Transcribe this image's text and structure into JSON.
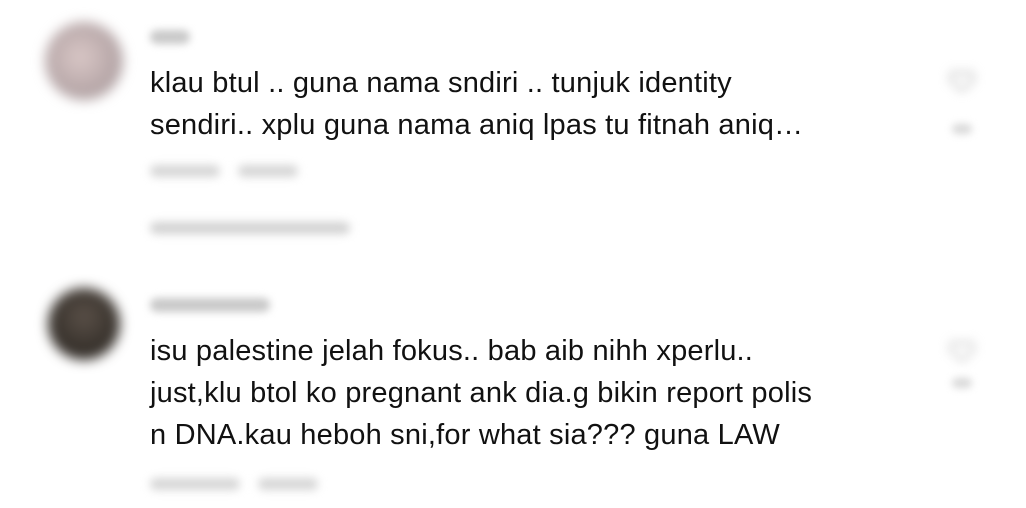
{
  "comments": [
    {
      "line1": "klau btul .. guna nama sndiri .. tunjuk identity",
      "line2": "sendiri.. xplu guna nama aniq lpas tu fitnah aniq…",
      "line3": "",
      "avatar_color": "#b9a9aa"
    },
    {
      "line1": "isu palestine jelah fokus.. bab aib nihh xperlu..",
      "line2": "just,klu btol ko pregnant ank dia.g bikin report polis",
      "line3": "n DNA.kau heboh sni,for what sia??? guna LAW",
      "avatar_color": "#3a342e"
    }
  ],
  "colors": {
    "text": "#111111",
    "meta_text": "#9a9a9a",
    "background": "#ffffff"
  },
  "icons": [
    "heart-icon",
    "avatar"
  ]
}
